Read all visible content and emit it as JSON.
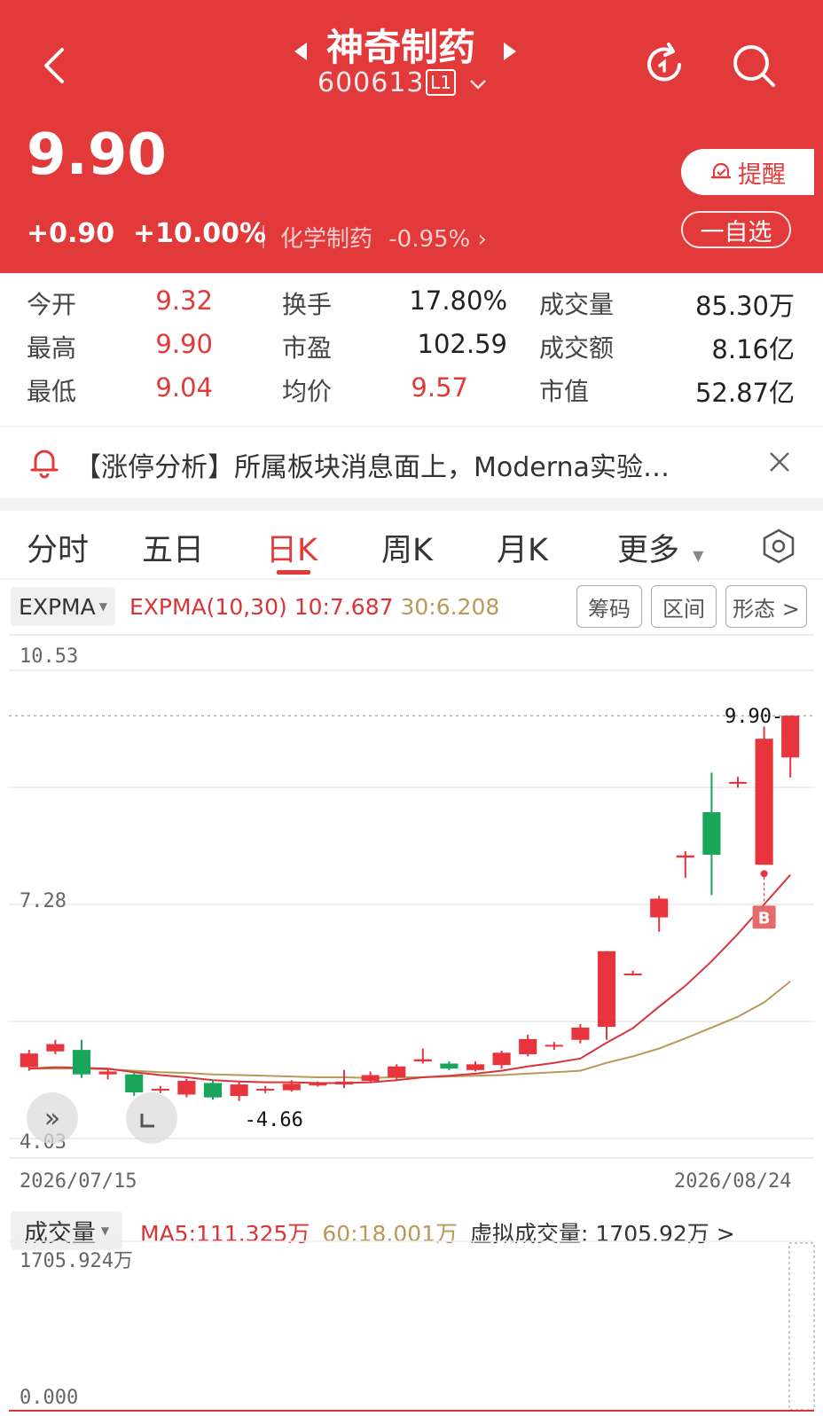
{
  "header": {
    "stock_name": "神奇制药",
    "stock_code": "600613",
    "level_badge": "L1",
    "price": "9.90",
    "change": "+0.90",
    "change_pct": "+10.00%",
    "sector_name": "化学制药",
    "sector_change": "-0.95%",
    "remind_label": "提醒",
    "watchlist_label": "一自选"
  },
  "quote": {
    "rows": [
      [
        {
          "label": "今开",
          "value": "9.32"
        },
        {
          "label": "换手",
          "value": "17.80%"
        },
        {
          "label": "成交量",
          "value": "85.30万"
        }
      ],
      [
        {
          "label": "最高",
          "value": "9.90"
        },
        {
          "label": "市盈",
          "value": "102.59"
        },
        {
          "label": "成交额",
          "value": "8.16亿"
        }
      ],
      [
        {
          "label": "最低",
          "value": "9.04"
        },
        {
          "label": "均价",
          "value": "9.57"
        },
        {
          "label": "市值",
          "value": "52.87亿"
        }
      ]
    ]
  },
  "news": {
    "text": "【涨停分析】所属板块消息面上，Moderna实验…"
  },
  "tabs": [
    "分时",
    "五日",
    "日K",
    "周K",
    "月K",
    "更多"
  ],
  "active_tab": "日K",
  "indicator": {
    "name": "EXPMA",
    "params": "EXPMA(10,30)",
    "ema10": "10:7.687",
    "ema30": "30:6.208",
    "buttons": [
      "筹码",
      "区间",
      "形态 >"
    ]
  },
  "chart_data": {
    "type": "candlestick",
    "y_labels": [
      "10.53",
      "7.28",
      "4.03"
    ],
    "ylim": [
      4.03,
      10.53
    ],
    "x_start_label": "2026/07/15",
    "x_end_label": "2026/08/24",
    "max_marker": "9.90",
    "min_marker": "4.66",
    "buy_marker": "B",
    "candles": [
      {
        "o": 5.02,
        "c": 5.21,
        "h": 5.26,
        "l": 4.97
      },
      {
        "o": 5.24,
        "c": 5.34,
        "h": 5.4,
        "l": 5.2
      },
      {
        "o": 5.26,
        "c": 4.92,
        "h": 5.4,
        "l": 4.87
      },
      {
        "o": 4.92,
        "c": 4.96,
        "h": 5.0,
        "l": 4.85
      },
      {
        "o": 4.92,
        "c": 4.67,
        "h": 4.94,
        "l": 4.62
      },
      {
        "o": 4.7,
        "c": 4.72,
        "h": 4.76,
        "l": 4.66
      },
      {
        "o": 4.64,
        "c": 4.83,
        "h": 4.86,
        "l": 4.6
      },
      {
        "o": 4.8,
        "c": 4.6,
        "h": 4.85,
        "l": 4.57
      },
      {
        "o": 4.62,
        "c": 4.78,
        "h": 4.82,
        "l": 4.55
      },
      {
        "o": 4.72,
        "c": 4.72,
        "h": 4.76,
        "l": 4.66
      },
      {
        "o": 4.7,
        "c": 4.79,
        "h": 4.84,
        "l": 4.68
      },
      {
        "o": 4.78,
        "c": 4.79,
        "h": 4.82,
        "l": 4.75
      },
      {
        "o": 4.78,
        "c": 4.82,
        "h": 4.98,
        "l": 4.73
      },
      {
        "o": 4.83,
        "c": 4.91,
        "h": 4.96,
        "l": 4.8
      },
      {
        "o": 4.88,
        "c": 5.03,
        "h": 5.06,
        "l": 4.85
      },
      {
        "o": 5.1,
        "c": 5.13,
        "h": 5.28,
        "l": 5.07
      },
      {
        "o": 5.07,
        "c": 5.0,
        "h": 5.1,
        "l": 4.98
      },
      {
        "o": 4.98,
        "c": 5.06,
        "h": 5.1,
        "l": 4.96
      },
      {
        "o": 5.05,
        "c": 5.22,
        "h": 5.25,
        "l": 5.0
      },
      {
        "o": 5.2,
        "c": 5.41,
        "h": 5.47,
        "l": 5.17
      },
      {
        "o": 5.32,
        "c": 5.33,
        "h": 5.37,
        "l": 5.26
      },
      {
        "o": 5.4,
        "c": 5.57,
        "h": 5.62,
        "l": 5.35
      },
      {
        "o": 5.58,
        "c": 6.63,
        "h": 6.63,
        "l": 5.4
      },
      {
        "o": 6.3,
        "c": 6.32,
        "h": 6.36,
        "l": 6.29
      },
      {
        "o": 7.1,
        "c": 7.36,
        "h": 7.4,
        "l": 6.9
      },
      {
        "o": 7.93,
        "c": 7.96,
        "h": 8.02,
        "l": 7.65
      },
      {
        "o": 8.56,
        "c": 7.97,
        "h": 9.11,
        "l": 7.41
      },
      {
        "o": 8.96,
        "c": 8.98,
        "h": 9.05,
        "l": 8.9
      },
      {
        "o": 7.83,
        "c": 9.58,
        "h": 9.75,
        "l": 7.83
      },
      {
        "o": 9.32,
        "c": 9.9,
        "h": 9.9,
        "l": 9.04
      }
    ],
    "ema10": [
      5.0,
      5.02,
      5.01,
      5.0,
      4.95,
      4.91,
      4.88,
      4.84,
      4.82,
      4.81,
      4.81,
      4.8,
      4.8,
      4.81,
      4.84,
      4.88,
      4.9,
      4.93,
      4.97,
      5.03,
      5.08,
      5.14,
      5.36,
      5.56,
      5.86,
      6.15,
      6.49,
      6.87,
      7.28,
      7.69
    ],
    "ema30": [
      5.0,
      5.0,
      5.0,
      4.99,
      4.97,
      4.95,
      4.94,
      4.92,
      4.91,
      4.9,
      4.89,
      4.88,
      4.88,
      4.87,
      4.88,
      4.88,
      4.89,
      4.9,
      4.91,
      4.93,
      4.95,
      4.97,
      5.08,
      5.17,
      5.28,
      5.42,
      5.57,
      5.72,
      5.92,
      6.21
    ]
  },
  "volume": {
    "label": "成交量",
    "ma5": "MA5:111.325万",
    "ma60": "60:18.001万",
    "virtual_label": "虚拟成交量: 1705.92万 >",
    "max_label": "1705.924万",
    "min_label": "0.000"
  },
  "colors": {
    "header_red": "#e23a3a",
    "up": "#e8343c",
    "down": "#1aa65a",
    "ema10": "#d9343a",
    "ema30": "#b79a5a"
  }
}
